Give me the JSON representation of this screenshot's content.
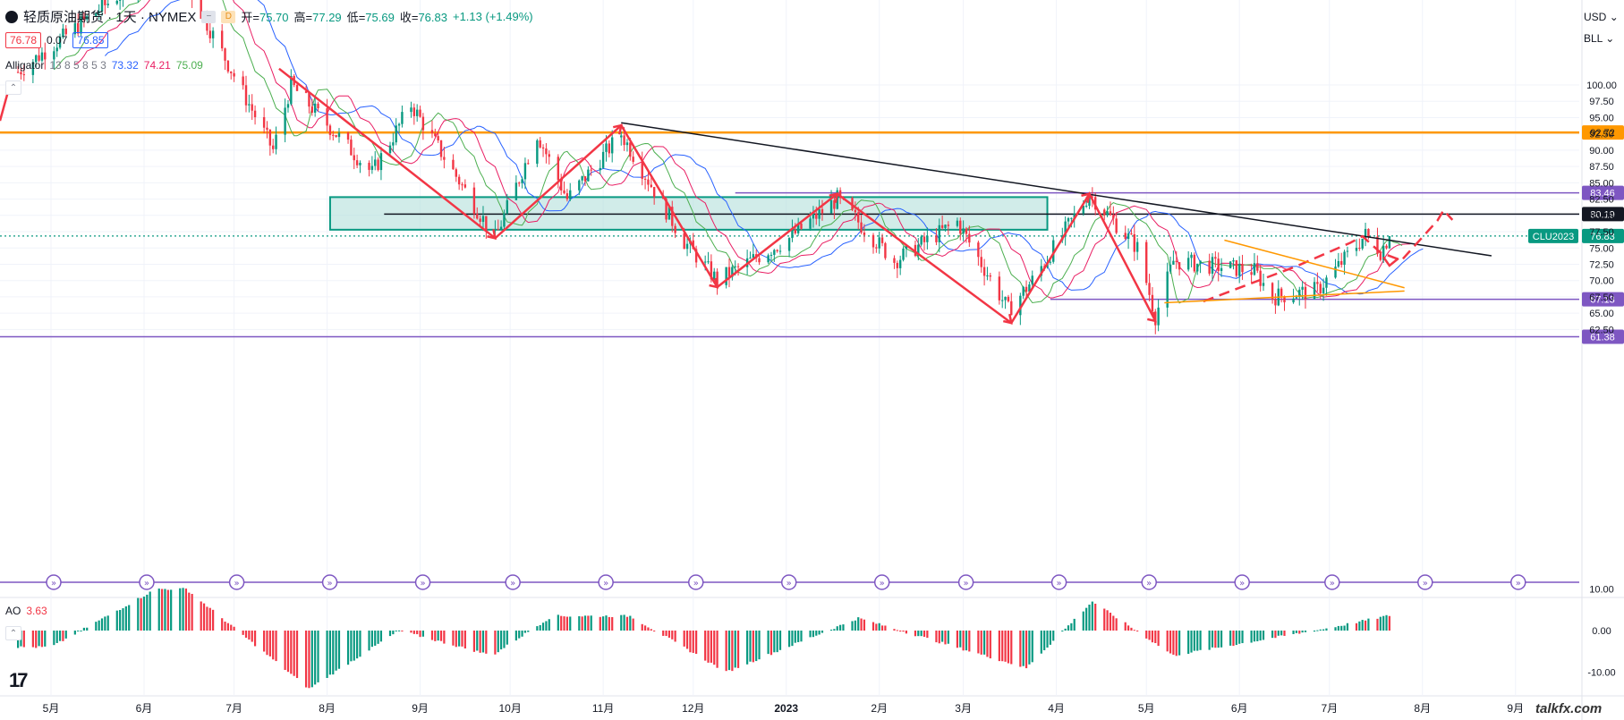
{
  "header": {
    "symbol_title": "轻质原油期货 · 1天 · NYMEX",
    "ohlc": [
      {
        "key": "开",
        "value": "75.70"
      },
      {
        "key": "高",
        "value": "77.29"
      },
      {
        "key": "低",
        "value": "75.69"
      },
      {
        "key": "收",
        "value": "76.83"
      }
    ],
    "change": "+1.13 (+1.49%)",
    "bid": "76.78",
    "spread": "0.07",
    "ask": "76.85",
    "indicator_name": "Alligator",
    "indicator_params": "13 8 5 8 5 3",
    "alligator_values": [
      "73.32",
      "74.21",
      "75.09"
    ],
    "day_btn": "D"
  },
  "controls": {
    "currency": "USD",
    "unit": "BLL"
  },
  "ao": {
    "name": "AO",
    "value": "3.63"
  },
  "watermark": "talkfx.com",
  "colors": {
    "up": "#089981",
    "down": "#f23645",
    "lips": "#4caf50",
    "teeth": "#e91e63",
    "jaw": "#2962ff",
    "orange": "#ff9800",
    "purple": "#7e57c2",
    "zigzag": "#f23645",
    "zone_fill": "#b2dfdb",
    "zone_border": "#089981"
  },
  "chart_data": {
    "type": "candlestick",
    "symbol": "CLU2023",
    "last_price": 76.83,
    "y_ticks": [
      62.5,
      65.0,
      67.5,
      70.0,
      72.5,
      75.0,
      77.5,
      80.0,
      82.5,
      85.0,
      87.5,
      90.0,
      92.5,
      95.0,
      97.5,
      100.0
    ],
    "y_tick_labels": [
      "62.50",
      "65.00",
      "67.50",
      "70.00",
      "72.50",
      "75.00",
      "77.50",
      "80.00",
      "82.50",
      "85.00",
      "87.50",
      "90.00",
      "92.50",
      "95.00",
      "97.50",
      "100.00"
    ],
    "x_labels": [
      "5月",
      "6月",
      "7月",
      "8月",
      "9月",
      "10月",
      "11月",
      "12月",
      "2023",
      "2月",
      "3月",
      "4月",
      "5月",
      "6月",
      "7月",
      "8月",
      "9月"
    ],
    "price_path": [
      {
        "date": "2022-04-20",
        "price": 102.0
      },
      {
        "date": "2022-06-10",
        "price": 120.0
      },
      {
        "date": "2022-07-14",
        "price": 90.0
      },
      {
        "date": "2022-07-20",
        "price": 100.0
      },
      {
        "date": "2022-08-16",
        "price": 86.5
      },
      {
        "date": "2022-08-29",
        "price": 97.0
      },
      {
        "date": "2022-09-26",
        "price": 76.5
      },
      {
        "date": "2022-10-10",
        "price": 92.5
      },
      {
        "date": "2022-10-20",
        "price": 82.5
      },
      {
        "date": "2022-11-07",
        "price": 92.5
      },
      {
        "date": "2022-11-28",
        "price": 76.0
      },
      {
        "date": "2022-12-09",
        "price": 70.0
      },
      {
        "date": "2023-01-02",
        "price": 76.5
      },
      {
        "date": "2023-01-18",
        "price": 82.5
      },
      {
        "date": "2023-02-06",
        "price": 73.0
      },
      {
        "date": "2023-02-27",
        "price": 79.0
      },
      {
        "date": "2023-03-16",
        "price": 65.5
      },
      {
        "date": "2023-03-24",
        "price": 70.0
      },
      {
        "date": "2023-04-12",
        "price": 83.3
      },
      {
        "date": "2023-04-28",
        "price": 75.0
      },
      {
        "date": "2023-05-04",
        "price": 64.5
      },
      {
        "date": "2023-05-10",
        "price": 73.0
      },
      {
        "date": "2023-06-06",
        "price": 71.5
      },
      {
        "date": "2023-06-12",
        "price": 67.5
      },
      {
        "date": "2023-06-27",
        "price": 68.5
      },
      {
        "date": "2023-07-13",
        "price": 77.0
      },
      {
        "date": "2023-07-18",
        "price": 74.5
      },
      {
        "date": "2023-07-21",
        "price": 76.83
      }
    ],
    "ao_path": [
      {
        "date": "2022-05-01",
        "value": -4.0
      },
      {
        "date": "2022-06-05",
        "value": 10.0
      },
      {
        "date": "2022-06-15",
        "value": 10.0
      },
      {
        "date": "2022-07-26",
        "value": -14.0
      },
      {
        "date": "2022-08-25",
        "value": 0.0
      },
      {
        "date": "2022-09-25",
        "value": -6.0
      },
      {
        "date": "2022-10-15",
        "value": 3.5
      },
      {
        "date": "2022-11-10",
        "value": 3.5
      },
      {
        "date": "2022-12-12",
        "value": -10.0
      },
      {
        "date": "2023-01-25",
        "value": 3.0
      },
      {
        "date": "2023-03-22",
        "value": -9.0
      },
      {
        "date": "2023-04-13",
        "value": 7.0
      },
      {
        "date": "2023-05-10",
        "value": -6.0
      },
      {
        "date": "2023-06-30",
        "value": 0.5
      },
      {
        "date": "2023-07-21",
        "value": 3.63
      }
    ],
    "ao_y_tick_labels": [
      "10.00",
      "0.00",
      "-10.00"
    ],
    "ao_y_ticks": [
      10,
      0,
      -10
    ],
    "horizontal_levels": [
      {
        "value": 92.72,
        "label": "92.72",
        "color": "#ff9800"
      },
      {
        "value": 83.46,
        "label": "83.46",
        "color": "#7e57c2"
      },
      {
        "value": 80.19,
        "label": "80.19",
        "color": "#131722"
      },
      {
        "value": 67.13,
        "label": "67.13",
        "color": "#7e57c2"
      },
      {
        "value": 61.38,
        "label": "61.38",
        "color": "#7e57c2"
      }
    ],
    "last_price_tag": {
      "symbol": "CLU2023",
      "value": "76.83"
    },
    "zone": {
      "from": "2022-08-02",
      "to": "2023-03-29",
      "low": 77.8,
      "high": 82.8
    },
    "trendline": [
      {
        "date": "2022-11-07",
        "price": 94.2
      },
      {
        "date": "2023-08-24",
        "price": 73.8
      }
    ],
    "zigzag": [
      {
        "date": "2022-07-16",
        "price": 102.5
      },
      {
        "date": "2022-09-26",
        "price": 76.5
      },
      {
        "date": "2022-11-07",
        "price": 93.8
      },
      {
        "date": "2022-12-09",
        "price": 69.0
      },
      {
        "date": "2023-01-18",
        "price": 83.3
      },
      {
        "date": "2023-03-17",
        "price": 63.5
      },
      {
        "date": "2023-04-12",
        "price": 83.3
      },
      {
        "date": "2023-05-04",
        "price": 63.8
      }
    ],
    "cycle_markers": [
      "2022-04-01",
      "2022-05-01",
      "2022-06-01",
      "2022-07-01",
      "2022-08-01",
      "2022-09-01",
      "2022-10-01",
      "2022-11-01",
      "2022-12-01",
      "2023-01-01",
      "2023-02-01",
      "2023-03-01",
      "2023-04-01",
      "2023-05-01",
      "2023-06-01",
      "2023-07-01",
      "2023-08-01",
      "2023-09-01"
    ]
  }
}
